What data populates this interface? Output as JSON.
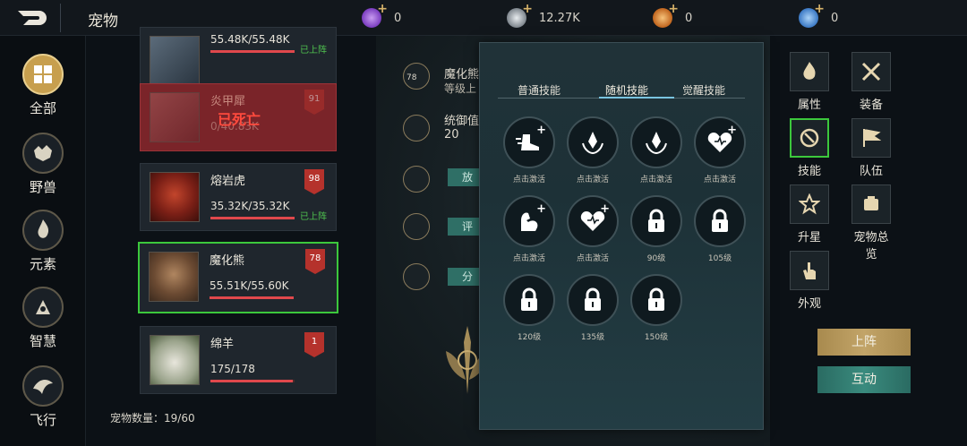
{
  "header": {
    "title": "宠物",
    "resources": [
      {
        "icon": "purple-gem-icon",
        "value": "0",
        "color": "#8b52c8"
      },
      {
        "icon": "silver-coin-icon",
        "value": "12.27K",
        "color": "#a8adb3"
      },
      {
        "icon": "orange-gem-icon",
        "value": "0",
        "color": "#d17a2b"
      },
      {
        "icon": "blue-gem-icon",
        "value": "0",
        "color": "#4b8fd6"
      }
    ]
  },
  "leftnav": {
    "items": [
      {
        "label": "全部",
        "icon": "grid-icon"
      },
      {
        "label": "野兽",
        "icon": "beast-icon"
      },
      {
        "label": "元素",
        "icon": "element-icon"
      },
      {
        "label": "智慧",
        "icon": "wisdom-icon"
      },
      {
        "label": "飞行",
        "icon": "flight-icon"
      }
    ]
  },
  "pets": [
    {
      "name": "",
      "hp": "55.48K/55.48K",
      "hp_fraction": 1.0,
      "status": "已上阵",
      "level": ""
    },
    {
      "name": "炎甲犀",
      "hp": "0/40.83K",
      "hp_fraction": 0,
      "status": "已死亡",
      "level": "91"
    },
    {
      "name": "熔岩虎",
      "hp": "35.32K/35.32K",
      "hp_fraction": 1.0,
      "status": "已上阵",
      "level": "98"
    },
    {
      "name": "魔化熊",
      "hp": "55.51K/55.60K",
      "hp_fraction": 0.998,
      "status": "",
      "level": "78"
    },
    {
      "name": "绵羊",
      "hp": "175/178",
      "hp_fraction": 0.98,
      "status": "",
      "level": "1"
    }
  ],
  "petcount": {
    "label": "宠物数量：",
    "value": "19/60"
  },
  "detail": {
    "name": "魔化熊",
    "level_text": "等级上",
    "level_badge": "78",
    "defense_label": "统御值",
    "defense_value": "20",
    "btn_release": "放",
    "btn_eval": "评",
    "btn_share": "分"
  },
  "skillpanel": {
    "tabs": [
      "普通技能",
      "随机技能",
      "觉醒技能"
    ],
    "active_tab": 1,
    "skills": [
      {
        "caption": "点击激活",
        "icon": "speed-boot-icon"
      },
      {
        "caption": "点击激活",
        "icon": "crystal-wreath-icon"
      },
      {
        "caption": "点击激活",
        "icon": "crystal-wreath-icon"
      },
      {
        "caption": "点击激活",
        "icon": "heart-plus-icon"
      },
      {
        "caption": "点击激活",
        "icon": "strength-arm-icon"
      },
      {
        "caption": "点击激活",
        "icon": "heart-plus-icon"
      },
      {
        "caption": "90级",
        "icon": "lock-icon"
      },
      {
        "caption": "105级",
        "icon": "lock-icon"
      },
      {
        "caption": "120级",
        "icon": "lock-icon"
      },
      {
        "caption": "135级",
        "icon": "lock-icon"
      },
      {
        "caption": "150级",
        "icon": "lock-icon"
      }
    ]
  },
  "rightactions": [
    {
      "label": "属性",
      "icon": "fire-icon"
    },
    {
      "label": "装备",
      "icon": "crossed-swords-icon"
    },
    {
      "label": "技能",
      "icon": "skill-icon"
    },
    {
      "label": "队伍",
      "icon": "flag-icon"
    },
    {
      "label": "升星",
      "icon": "star-icon"
    },
    {
      "label": "宠物总览",
      "icon": "overview-icon"
    },
    {
      "label": "外观",
      "icon": "hand-icon"
    }
  ],
  "buttons": {
    "deploy": "上阵",
    "interact": "互动"
  }
}
